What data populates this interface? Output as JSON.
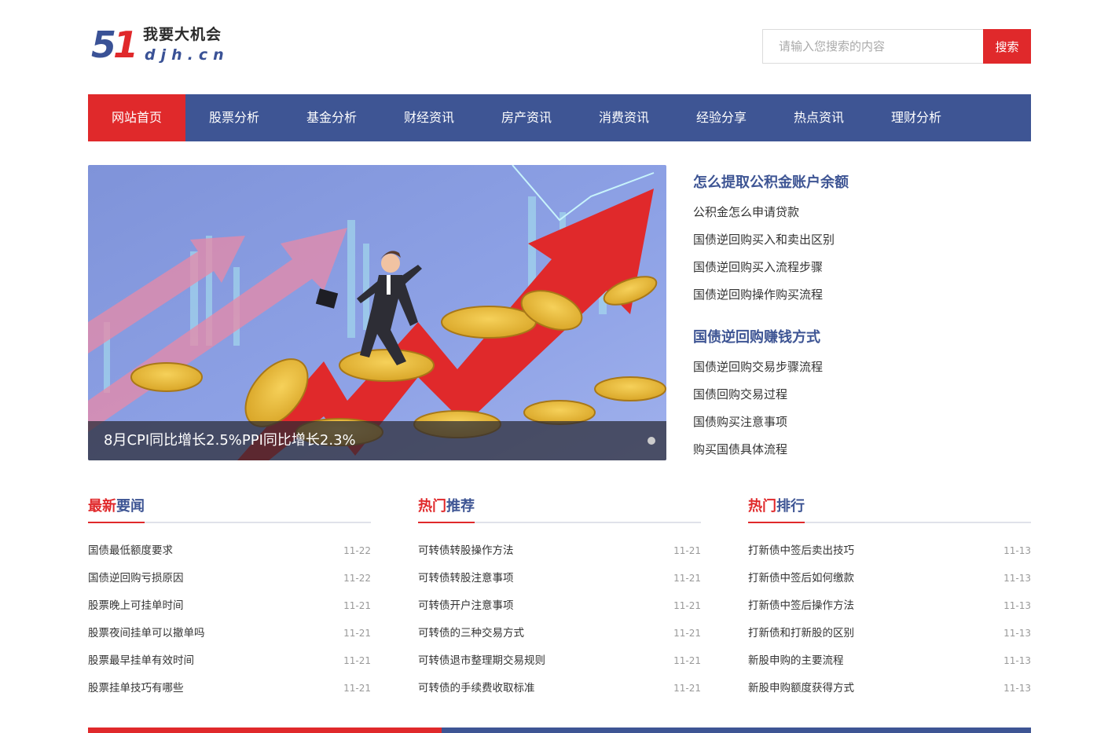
{
  "logo": {
    "digit5": "5",
    "digit1": "1",
    "cn": "我要大机会",
    "en": "djh.cn"
  },
  "search": {
    "placeholder": "请输入您搜索的内容",
    "button": "搜索"
  },
  "nav": [
    {
      "label": "网站首页",
      "active": true
    },
    {
      "label": "股票分析"
    },
    {
      "label": "基金分析"
    },
    {
      "label": "财经资讯"
    },
    {
      "label": "房产资讯"
    },
    {
      "label": "消费资讯"
    },
    {
      "label": "经验分享"
    },
    {
      "label": "热点资讯"
    },
    {
      "label": "理财分析"
    }
  ],
  "banner": {
    "caption": "8月CPI同比增长2.5%PPI同比增长2.3%"
  },
  "side": [
    {
      "title": "怎么提取公积金账户余额",
      "links": [
        "公积金怎么申请贷款",
        "国债逆回购买入和卖出区别",
        "国债逆回购买入流程步骤",
        "国债逆回购操作购买流程"
      ]
    },
    {
      "title": "国债逆回购赚钱方式",
      "links": [
        "国债逆回购交易步骤流程",
        "国债回购交易过程",
        "国债购买注意事项",
        "购买国债具体流程"
      ]
    }
  ],
  "columns": [
    {
      "title_red": "最新",
      "title_blue": "要闻",
      "items": [
        {
          "title": "国债最低额度要求",
          "date": "11-22"
        },
        {
          "title": "国债逆回购亏损原因",
          "date": "11-22"
        },
        {
          "title": "股票晚上可挂单时间",
          "date": "11-21"
        },
        {
          "title": "股票夜间挂单可以撤单吗",
          "date": "11-21"
        },
        {
          "title": "股票最早挂单有效时间",
          "date": "11-21"
        },
        {
          "title": "股票挂单技巧有哪些",
          "date": "11-21"
        }
      ]
    },
    {
      "title_red": "热门",
      "title_blue": "推荐",
      "items": [
        {
          "title": "可转债转股操作方法",
          "date": "11-21"
        },
        {
          "title": "可转债转股注意事项",
          "date": "11-21"
        },
        {
          "title": "可转债开户注意事项",
          "date": "11-21"
        },
        {
          "title": "可转债的三种交易方式",
          "date": "11-21"
        },
        {
          "title": "可转债退市整理期交易规则",
          "date": "11-21"
        },
        {
          "title": "可转债的手续费收取标准",
          "date": "11-21"
        }
      ]
    },
    {
      "title_red": "热门",
      "title_blue": "排行",
      "items": [
        {
          "title": "打新债中签后卖出技巧",
          "date": "11-13"
        },
        {
          "title": "打新债中签后如何缴款",
          "date": "11-13"
        },
        {
          "title": "打新债中签后操作方法",
          "date": "11-13"
        },
        {
          "title": "打新债和打新股的区别",
          "date": "11-13"
        },
        {
          "title": "新股申购的主要流程",
          "date": "11-13"
        },
        {
          "title": "新股申购额度获得方式",
          "date": "11-13"
        }
      ]
    }
  ],
  "colors": {
    "brand_blue": "#3e5594",
    "brand_red": "#e0292b"
  }
}
